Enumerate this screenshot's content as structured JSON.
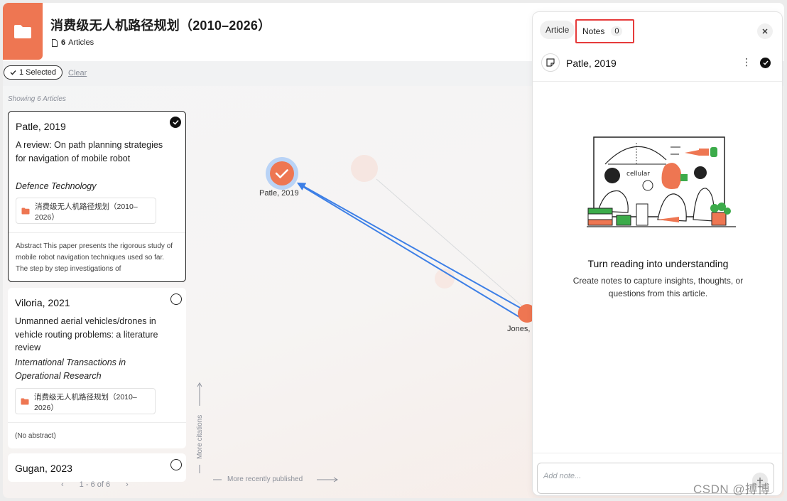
{
  "header": {
    "project_title": "消费级无人机路径规划（2010–2026）",
    "article_count": "6",
    "article_count_label": "Articles"
  },
  "selection": {
    "selected_label": "1 Selected",
    "clear_label": "Clear"
  },
  "list": {
    "showing_label": "Showing 6 Articles",
    "pager_text": "1 - 6 of 6",
    "cards": [
      {
        "author_year": "Patle, 2019",
        "title": "A review: On path planning strategies for navigation of mobile robot",
        "journal": "Defence Technology",
        "collection": "消费级无人机路径规划（2010–2026）",
        "abstract": "Abstract This paper presents the rigorous study of mobile robot navigation techniques used so far. The step by step investigations of",
        "selected": true
      },
      {
        "author_year": "Viloria, 2021",
        "title": "Unmanned aerial vehicles/drones in vehicle routing problems: a literature review",
        "journal": "International Transactions in Operational Research",
        "collection": "消费级无人机路径规划（2010–2026）",
        "abstract": "(No abstract)",
        "selected": false
      },
      {
        "author_year": "Gugan, 2023",
        "selected": false
      }
    ]
  },
  "graph": {
    "node_selected_label": "Patle, 2019",
    "node_other_label": "Jones, ",
    "axis_y_label": "More citations",
    "axis_x_label": "More recently published",
    "accent_color": "#ee7652",
    "edge_color": "#3d7fe6"
  },
  "notes_panel": {
    "tab_article": "Article",
    "tab_notes": "Notes",
    "notes_count": "0",
    "article_name": "Patle, 2019",
    "empty_title": "Turn reading into understanding",
    "empty_description": "Create notes to capture insights, thoughts, or questions from this article.",
    "add_note_placeholder": "Add note...",
    "illustration_text": "cellular"
  },
  "watermark": "CSDN @搏博"
}
